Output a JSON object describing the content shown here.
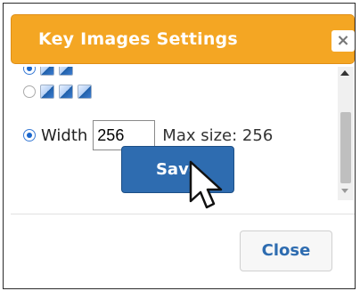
{
  "dialog": {
    "title": "Key Images Settings",
    "close_x": "×",
    "width_label": "Width",
    "width_value": "256",
    "max_size": "Max size: 256",
    "save_label": "Save",
    "close_label": "Close"
  },
  "colors": {
    "titlebar": "#f4a623",
    "save_button": "#2e6cb0"
  },
  "icons": [
    "mini-image-icon",
    "scroll-up-icon",
    "scroll-down-icon",
    "cursor-icon"
  ]
}
